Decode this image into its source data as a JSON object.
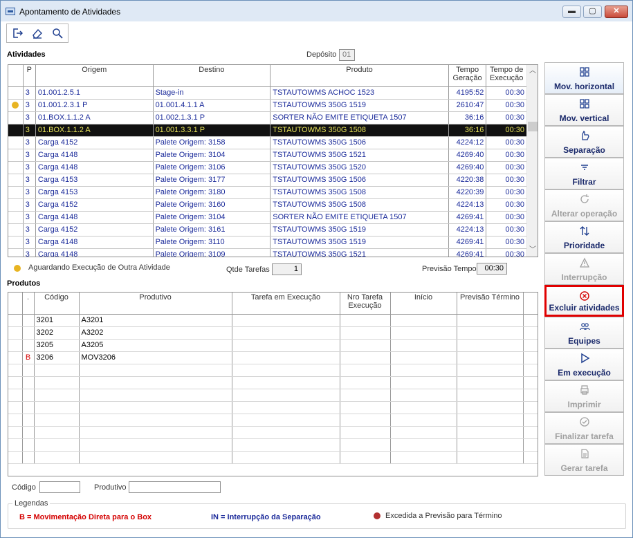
{
  "window": {
    "title": "Apontamento de Atividades",
    "min": "▬",
    "max": "▢",
    "close": "✕"
  },
  "atividades": {
    "title": "Atividades",
    "deposito_label": "Depósito",
    "deposito_value": "01",
    "columns": {
      "p": "P",
      "origem": "Origem",
      "destino": "Destino",
      "produto": "Produto",
      "tempo_geracao": "Tempo Geração",
      "tempo_execucao": "Tempo de Execução"
    },
    "rows": [
      {
        "dot": false,
        "p": "3",
        "origem": "01.001.2.5.1",
        "destino": "Stage-in",
        "produto": "TSTAUTOWMS ACHOC 1523",
        "ger": "4195:52",
        "exe": "00:30"
      },
      {
        "dot": true,
        "p": "3",
        "origem": "01.001.2.3.1 P",
        "destino": "01.001.4.1.1 A",
        "produto": "TSTAUTOWMS 350G 1519",
        "ger": "2610:47",
        "exe": "00:30"
      },
      {
        "dot": false,
        "p": "3",
        "origem": "01.BOX.1.1.2 A",
        "destino": "01.002.1.3.1 P",
        "produto": "SORTER NÃO EMITE ETIQUETA 1507",
        "ger": "36:16",
        "exe": "00:30"
      },
      {
        "dot": false,
        "p": "3",
        "origem": "01.BOX.1.1.2 A",
        "destino": "01.001.3.3.1 P",
        "produto": "TSTAUTOWMS 350G 1508",
        "ger": "36:16",
        "exe": "00:30",
        "selected": true
      },
      {
        "dot": false,
        "p": "3",
        "origem": "Carga 4152",
        "destino": "Palete Origem: 3158",
        "produto": "TSTAUTOWMS 350G 1506",
        "ger": "4224:12",
        "exe": "00:30"
      },
      {
        "dot": false,
        "p": "3",
        "origem": "Carga 4148",
        "destino": "Palete Origem: 3104",
        "produto": "TSTAUTOWMS 350G 1521",
        "ger": "4269:40",
        "exe": "00:30"
      },
      {
        "dot": false,
        "p": "3",
        "origem": "Carga 4148",
        "destino": "Palete Origem: 3106",
        "produto": "TSTAUTOWMS 350G 1520",
        "ger": "4269:40",
        "exe": "00:30"
      },
      {
        "dot": false,
        "p": "3",
        "origem": "Carga 4153",
        "destino": "Palete Origem: 3177",
        "produto": "TSTAUTOWMS 350G 1506",
        "ger": "4220:38",
        "exe": "00:30"
      },
      {
        "dot": false,
        "p": "3",
        "origem": "Carga 4153",
        "destino": "Palete Origem: 3180",
        "produto": "TSTAUTOWMS 350G 1508",
        "ger": "4220:39",
        "exe": "00:30"
      },
      {
        "dot": false,
        "p": "3",
        "origem": "Carga 4152",
        "destino": "Palete Origem: 3160",
        "produto": "TSTAUTOWMS 350G 1508",
        "ger": "4224:13",
        "exe": "00:30"
      },
      {
        "dot": false,
        "p": "3",
        "origem": "Carga 4148",
        "destino": "Palete Origem: 3104",
        "produto": "SORTER NÃO EMITE ETIQUETA 1507",
        "ger": "4269:41",
        "exe": "00:30"
      },
      {
        "dot": false,
        "p": "3",
        "origem": "Carga 4152",
        "destino": "Palete Origem: 3161",
        "produto": "TSTAUTOWMS 350G 1519",
        "ger": "4224:13",
        "exe": "00:30"
      },
      {
        "dot": false,
        "p": "3",
        "origem": "Carga 4148",
        "destino": "Palete Origem: 3110",
        "produto": "TSTAUTOWMS 350G 1519",
        "ger": "4269:41",
        "exe": "00:30"
      },
      {
        "dot": false,
        "p": "3",
        "origem": "Carga 4148",
        "destino": "Palete Origem: 3109",
        "produto": "TSTAUTOWMS 350G 1521",
        "ger": "4269:41",
        "exe": "00:30"
      }
    ],
    "legend_dot_label": "Aguardando Execução de Outra Atividade",
    "qtde_label": "Qtde Tarefas",
    "qtde_value": "1",
    "previsao_label": "Previsão Tempo",
    "previsao_value": "00:30"
  },
  "produtos": {
    "title": "Produtos",
    "columns": {
      "ind": ".",
      "codigo": "Código",
      "produtivo": "Produtivo",
      "tarefa": "Tarefa em Execução",
      "nro": "Nro Tarefa Execução",
      "inicio": "Início",
      "previsao": "Previsão Término"
    },
    "rows": [
      {
        "ind": "",
        "codigo": "3201",
        "produtivo": "A3201"
      },
      {
        "ind": "",
        "codigo": "3202",
        "produtivo": "A3202"
      },
      {
        "ind": "",
        "codigo": "3205",
        "produtivo": "A3205"
      },
      {
        "ind": "B",
        "codigo": "3206",
        "produtivo": "MOV3206"
      }
    ],
    "codigo_label": "Código",
    "produtivo_label": "Produtivo"
  },
  "sidebar": [
    {
      "label": "Mov. horizontal",
      "icon": "grid-icon",
      "disabled": false
    },
    {
      "label": "Mov. vertical",
      "icon": "grid-icon",
      "disabled": false
    },
    {
      "label": "Separação",
      "icon": "hand-icon",
      "disabled": false
    },
    {
      "label": "Filtrar",
      "icon": "filter-icon",
      "disabled": false
    },
    {
      "label": "Alterar operação",
      "icon": "refresh-icon",
      "disabled": true
    },
    {
      "label": "Prioridade",
      "icon": "sort-icon",
      "disabled": false
    },
    {
      "label": "Interrupção",
      "icon": "warning-icon",
      "disabled": true
    },
    {
      "label": "Excluir atividades",
      "icon": "delete-circle-icon",
      "disabled": false
    },
    {
      "label": "Equipes",
      "icon": "people-icon",
      "disabled": false
    },
    {
      "label": "Em execução",
      "icon": "play-icon",
      "disabled": false
    },
    {
      "label": "Imprimir",
      "icon": "print-icon",
      "disabled": true
    },
    {
      "label": "Finalizar tarefa",
      "icon": "check-circle-icon",
      "disabled": true
    },
    {
      "label": "Gerar tarefa",
      "icon": "document-icon",
      "disabled": true
    }
  ],
  "legendas": {
    "title": "Legendas",
    "b_text": "B = Movimentação Direta para o Box",
    "in_text": "IN = Interrupção da Separação",
    "excedida_text": "Excedida a Previsão para Término"
  },
  "colors": {
    "accent_blue": "#1a2a9a",
    "legend_red": "#d40000",
    "selected_fg": "#e8e35a"
  }
}
